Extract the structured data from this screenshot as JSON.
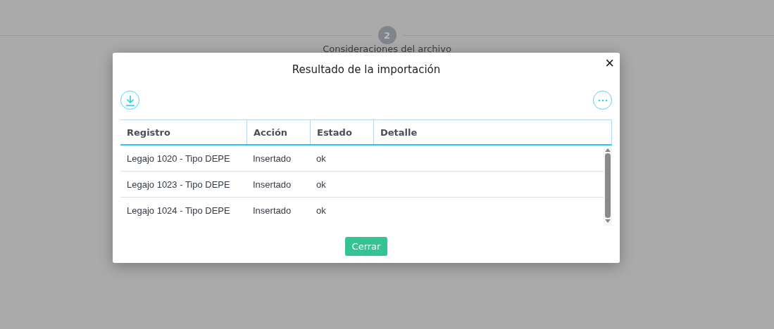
{
  "stepper": {
    "step_number": "2",
    "step_label": "Consideraciones del archivo"
  },
  "dialog": {
    "title": "Resultado de la importación",
    "close": "×",
    "table": {
      "columns": [
        "Registro",
        "Acción",
        "Estado",
        "Detalle"
      ],
      "rows": [
        {
          "cells": [
            "Legajo 1020 - Tipo DEPE",
            "Insertado",
            "ok",
            ""
          ]
        },
        {
          "cells": [
            "Legajo 1023 - Tipo DEPE",
            "Insertado",
            "ok",
            ""
          ]
        },
        {
          "cells": [
            "Legajo 1024 - Tipo DEPE",
            "Insertado",
            "ok",
            ""
          ]
        }
      ]
    },
    "button": "Cerrar"
  }
}
